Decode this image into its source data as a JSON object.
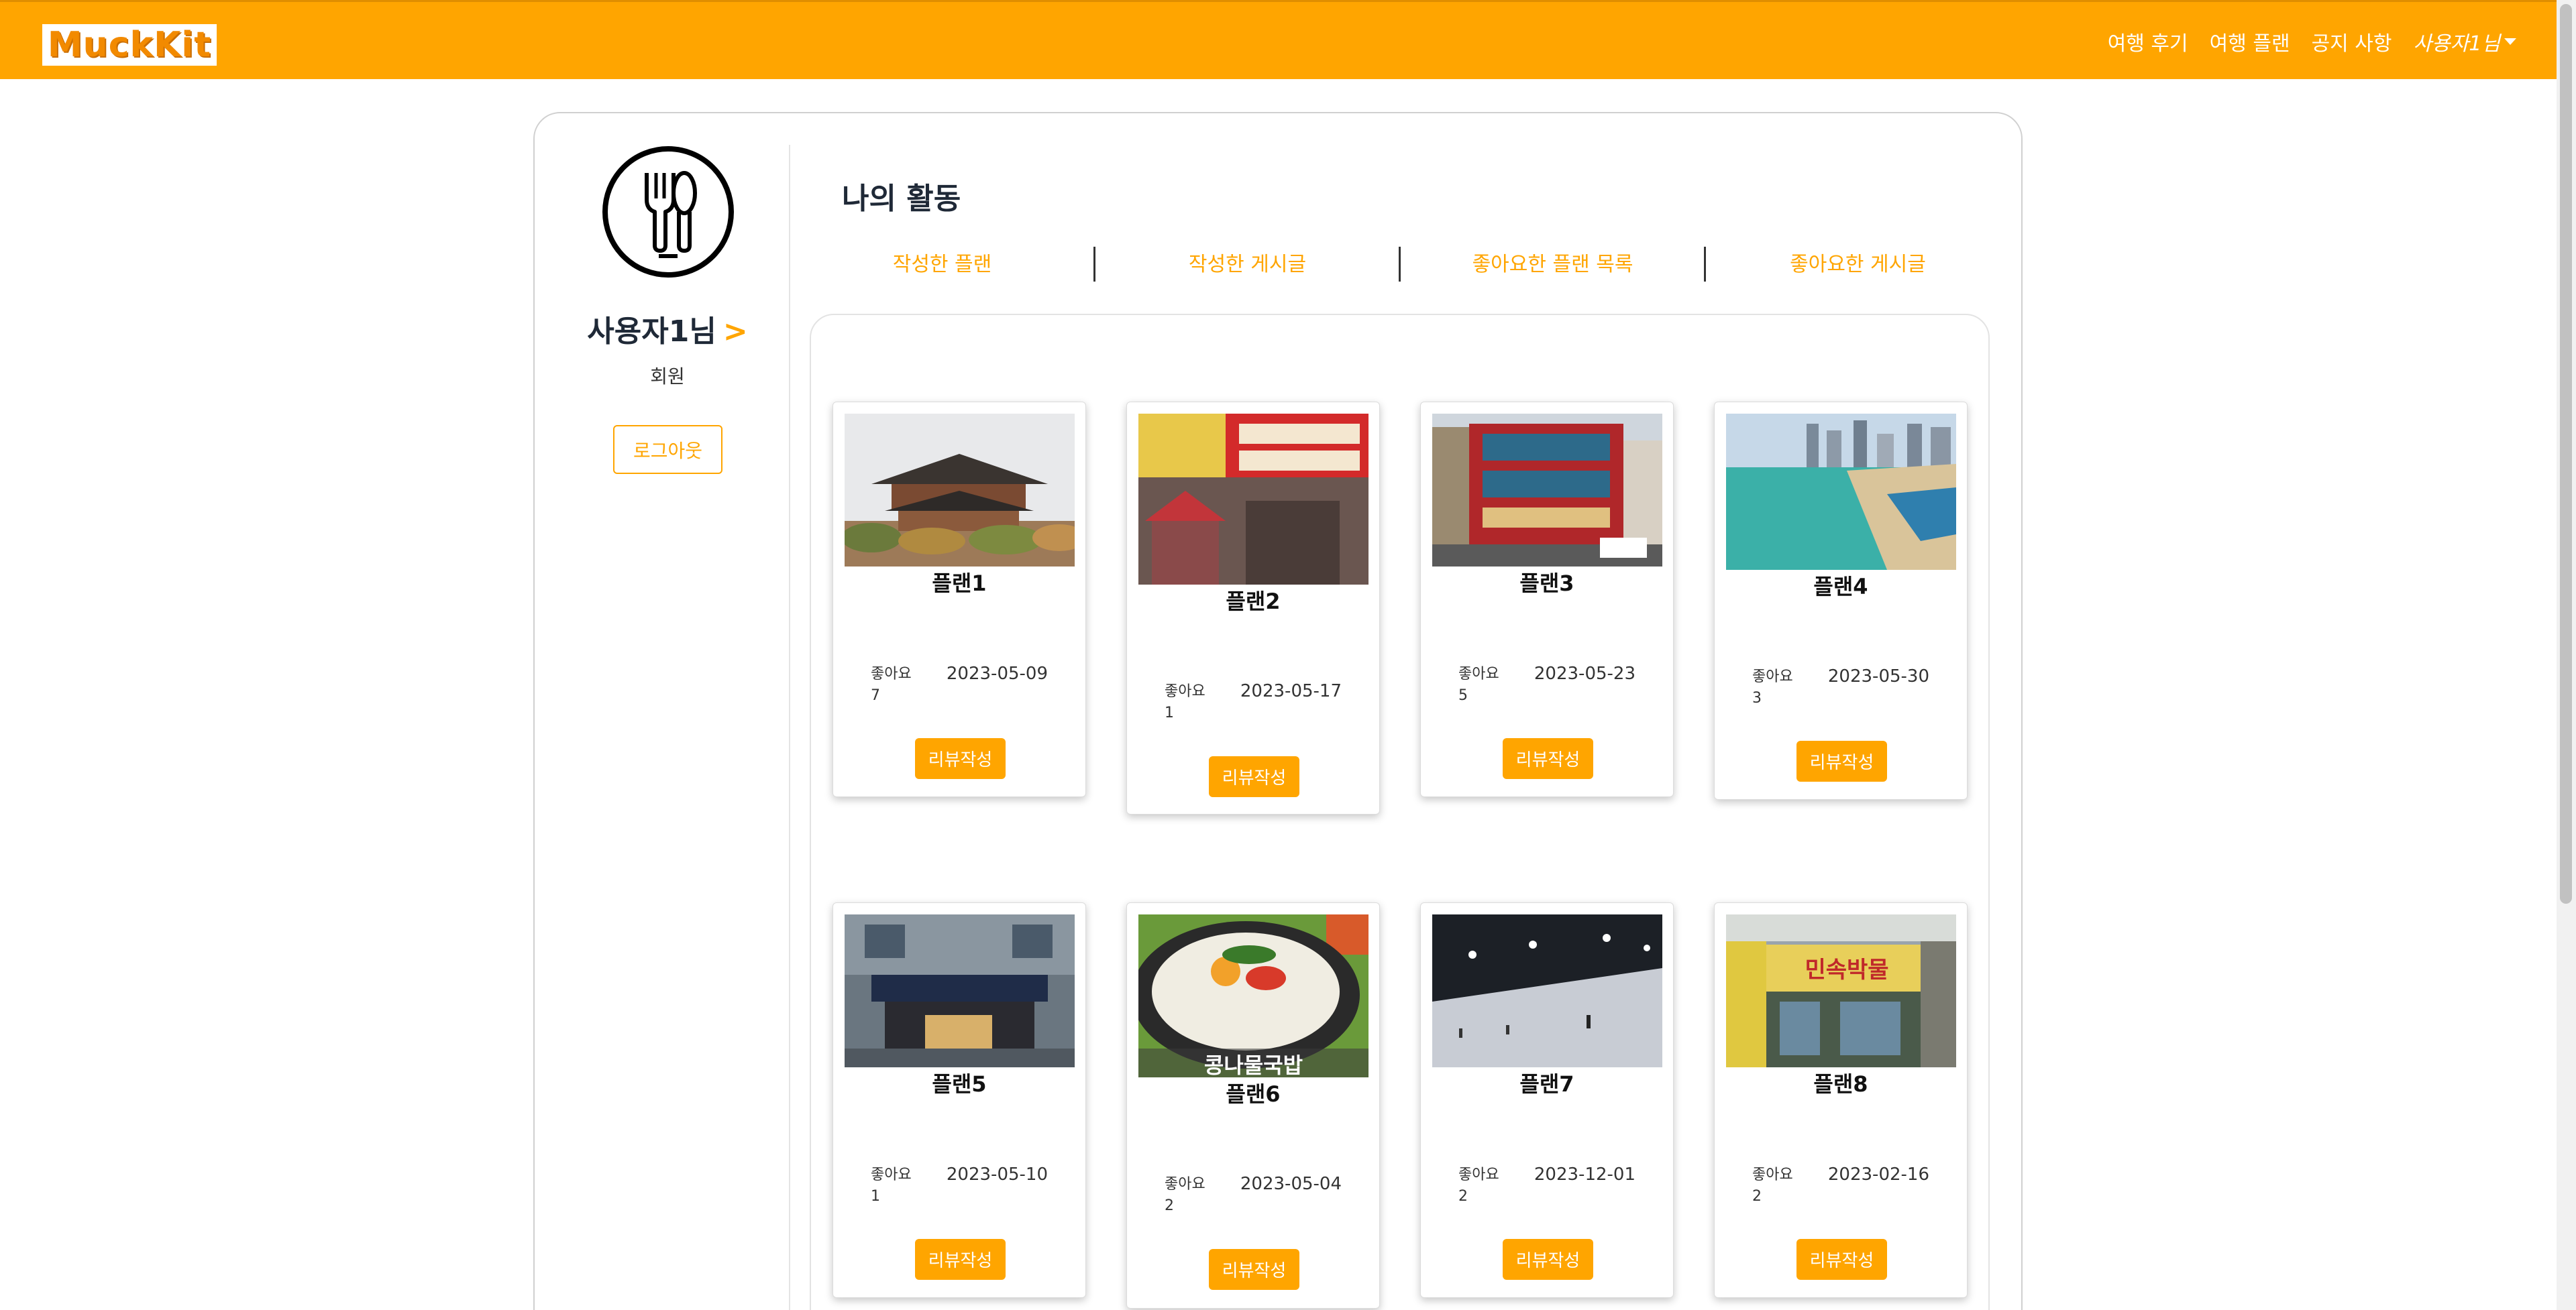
{
  "brand": {
    "logo_text": "MuckKit",
    "accent_color": "#ffa500"
  },
  "nav": {
    "links": [
      "여행 후기",
      "여행 플랜",
      "공지 사항"
    ],
    "user_menu": "사용자1님"
  },
  "profile": {
    "name": "사용자1님",
    "arrow": ">",
    "role": "회원",
    "logout_label": "로그아웃",
    "avatar_icon": "fork-spoon-icon"
  },
  "activity": {
    "title": "나의 활동",
    "tabs": [
      "작성한 플랜",
      "작성한 게시글",
      "좋아요한 플랜 목록",
      "좋아요한 게시글"
    ]
  },
  "plans": [
    {
      "title": "플랜1",
      "like_label": "좋아요",
      "likes": "7",
      "date": "2023-05-09",
      "button": "리뷰작성",
      "image": "palace"
    },
    {
      "title": "플랜2",
      "like_label": "좋아요",
      "likes": "1",
      "date": "2023-05-17",
      "button": "리뷰작성",
      "image": "restaurant-sign"
    },
    {
      "title": "플랜3",
      "like_label": "좋아요",
      "likes": "5",
      "date": "2023-05-23",
      "button": "리뷰작성",
      "image": "red-building"
    },
    {
      "title": "플랜4",
      "like_label": "좋아요",
      "likes": "3",
      "date": "2023-05-30",
      "button": "리뷰작성",
      "image": "beach-city"
    },
    {
      "title": "플랜5",
      "like_label": "좋아요",
      "likes": "1",
      "date": "2023-05-10",
      "button": "리뷰작성",
      "image": "night-storefront"
    },
    {
      "title": "플랜6",
      "like_label": "좋아요",
      "likes": "2",
      "date": "2023-05-04",
      "button": "리뷰작성",
      "image": "soup-bowl",
      "image_caption": "콩나물국밥"
    },
    {
      "title": "플랜7",
      "like_label": "좋아요",
      "likes": "2",
      "date": "2023-12-01",
      "button": "리뷰작성",
      "image": "ski-slope-night"
    },
    {
      "title": "플랜8",
      "like_label": "좋아요",
      "likes": "2",
      "date": "2023-02-16",
      "button": "리뷰작성",
      "image": "shop-street",
      "image_caption": "민속박물"
    }
  ]
}
